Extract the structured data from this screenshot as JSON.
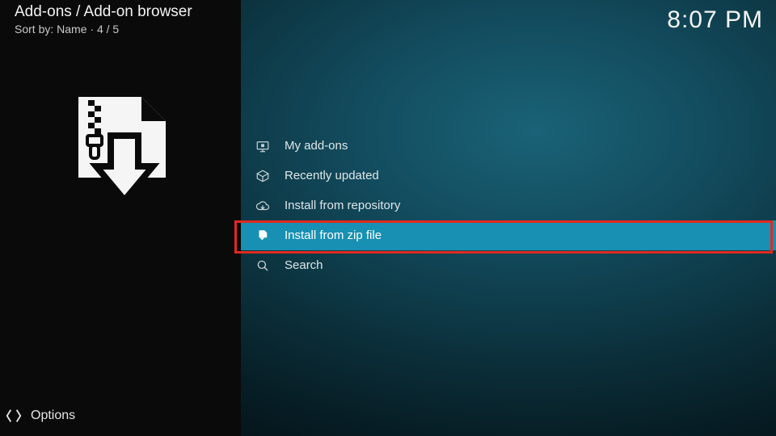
{
  "header": {
    "breadcrumb": "Add-ons / Add-on browser",
    "sort_prefix": "Sort by: ",
    "sort_value": "Name",
    "sort_sep": "  ·  ",
    "position": "4 / 5"
  },
  "clock": "8:07 PM",
  "menu": {
    "items": [
      {
        "label": "My add-ons",
        "icon": "monitor-addon-icon",
        "selected": false
      },
      {
        "label": "Recently updated",
        "icon": "open-box-icon",
        "selected": false
      },
      {
        "label": "Install from repository",
        "icon": "cloud-download-icon",
        "selected": false
      },
      {
        "label": "Install from zip file",
        "icon": "zip-download-icon",
        "selected": true
      },
      {
        "label": "Search",
        "icon": "search-icon",
        "selected": false
      }
    ]
  },
  "footer": {
    "options_label": "Options"
  }
}
